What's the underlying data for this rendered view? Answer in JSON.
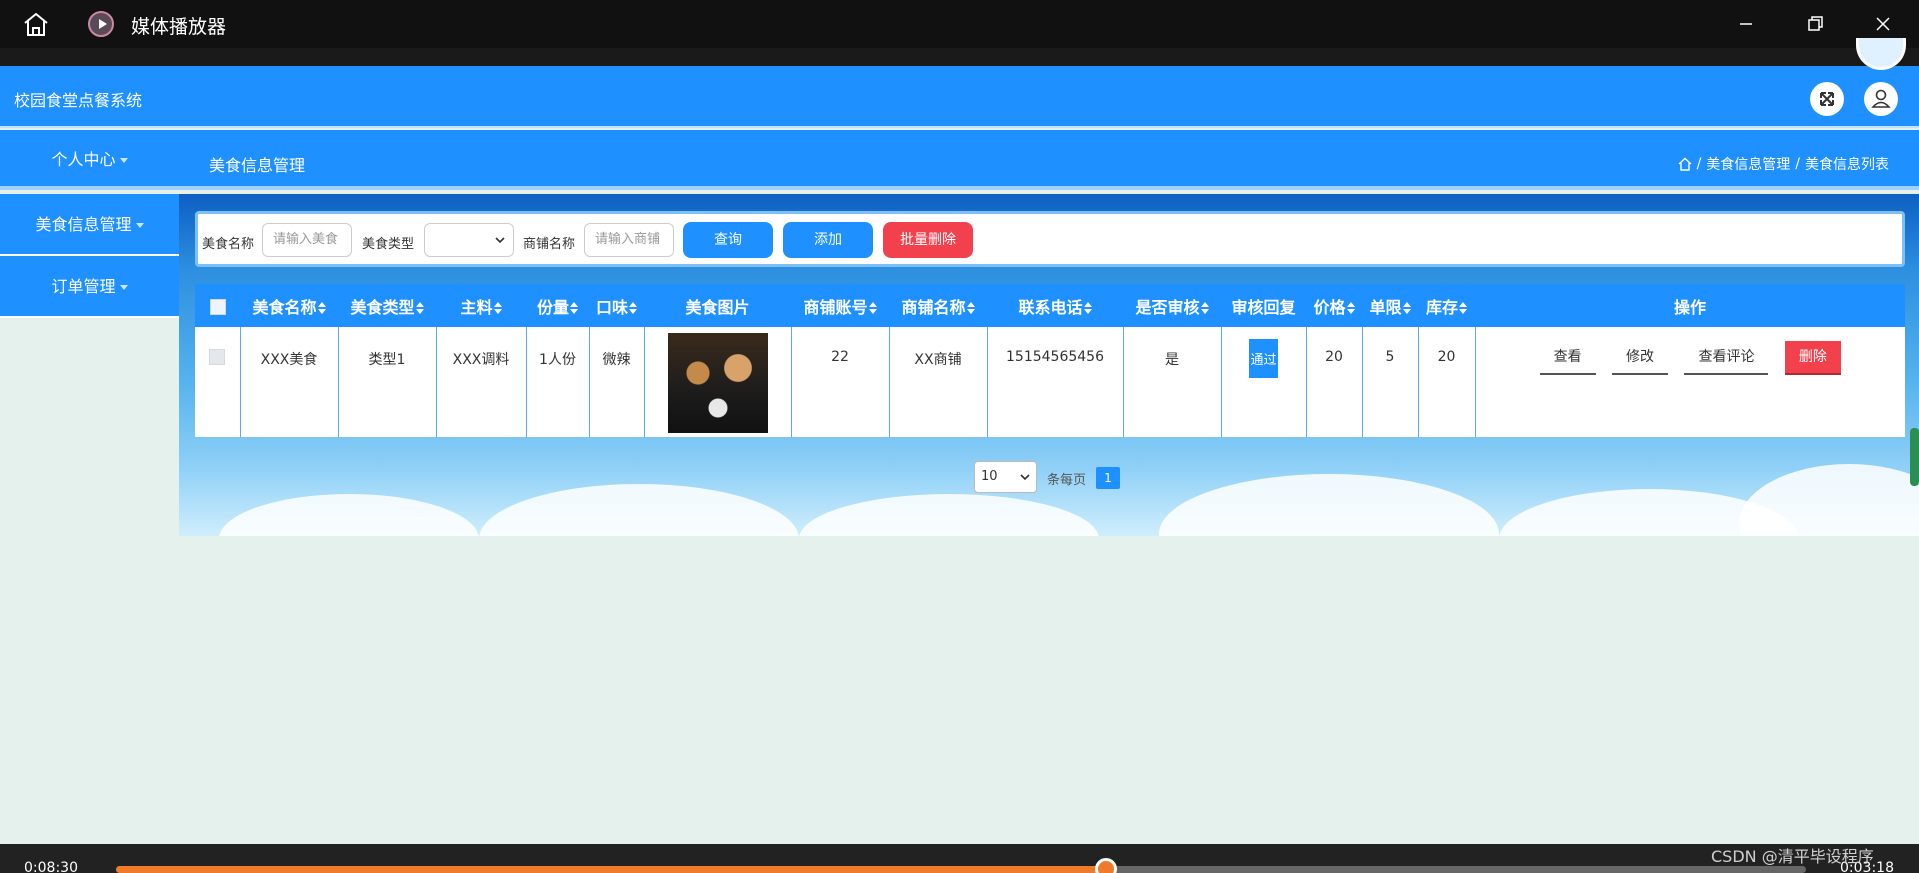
{
  "window": {
    "title": "媒体播放器"
  },
  "app": {
    "title": "校园食堂点餐系统"
  },
  "nav": {
    "top_item": "个人中心",
    "page_heading": "美食信息管理",
    "breadcrumb": [
      "美食信息管理",
      "美食信息列表"
    ],
    "breadcrumb_sep": "/"
  },
  "sidebar": {
    "items": [
      {
        "label": "美食信息管理"
      },
      {
        "label": "订单管理"
      }
    ]
  },
  "search": {
    "fields": [
      {
        "label": "美食名称",
        "placeholder": "请输入美食"
      },
      {
        "label": "美食类型",
        "value": ""
      },
      {
        "label": "商铺名称",
        "placeholder": "请输入商铺"
      }
    ],
    "buttons": {
      "query": "查询",
      "add": "添加",
      "batch_delete": "批量删除"
    }
  },
  "table": {
    "columns": [
      "美食名称",
      "美食类型",
      "主料",
      "份量",
      "口味",
      "美食图片",
      "商铺账号",
      "商铺名称",
      "联系电话",
      "是否审核",
      "审核回复",
      "价格",
      "单限",
      "库存",
      "操作"
    ],
    "rows": [
      {
        "name": "XXX美食",
        "type": "类型1",
        "main_ingredient": "XXX调料",
        "portion": "1人份",
        "taste": "微辣",
        "shop_account": "22",
        "shop_name": "XX商铺",
        "phone": "15154565456",
        "reviewed": "是",
        "review_reply": "通过",
        "price": "20",
        "limit": "5",
        "stock": "20",
        "actions": {
          "view": "查看",
          "edit": "修改",
          "view_comments": "查看评论",
          "delete": "删除"
        }
      }
    ]
  },
  "pagination": {
    "page_size": "10",
    "per_page_label": "条每页",
    "current_page": "1"
  },
  "player": {
    "elapsed": "0:08:30",
    "duration": "0:03:18",
    "progress": 0.586
  },
  "watermark": "CSDN @清平毕设程序",
  "colors": {
    "primary": "#1e90ff",
    "danger": "#f2414d",
    "progress": "#ee7a2a"
  }
}
